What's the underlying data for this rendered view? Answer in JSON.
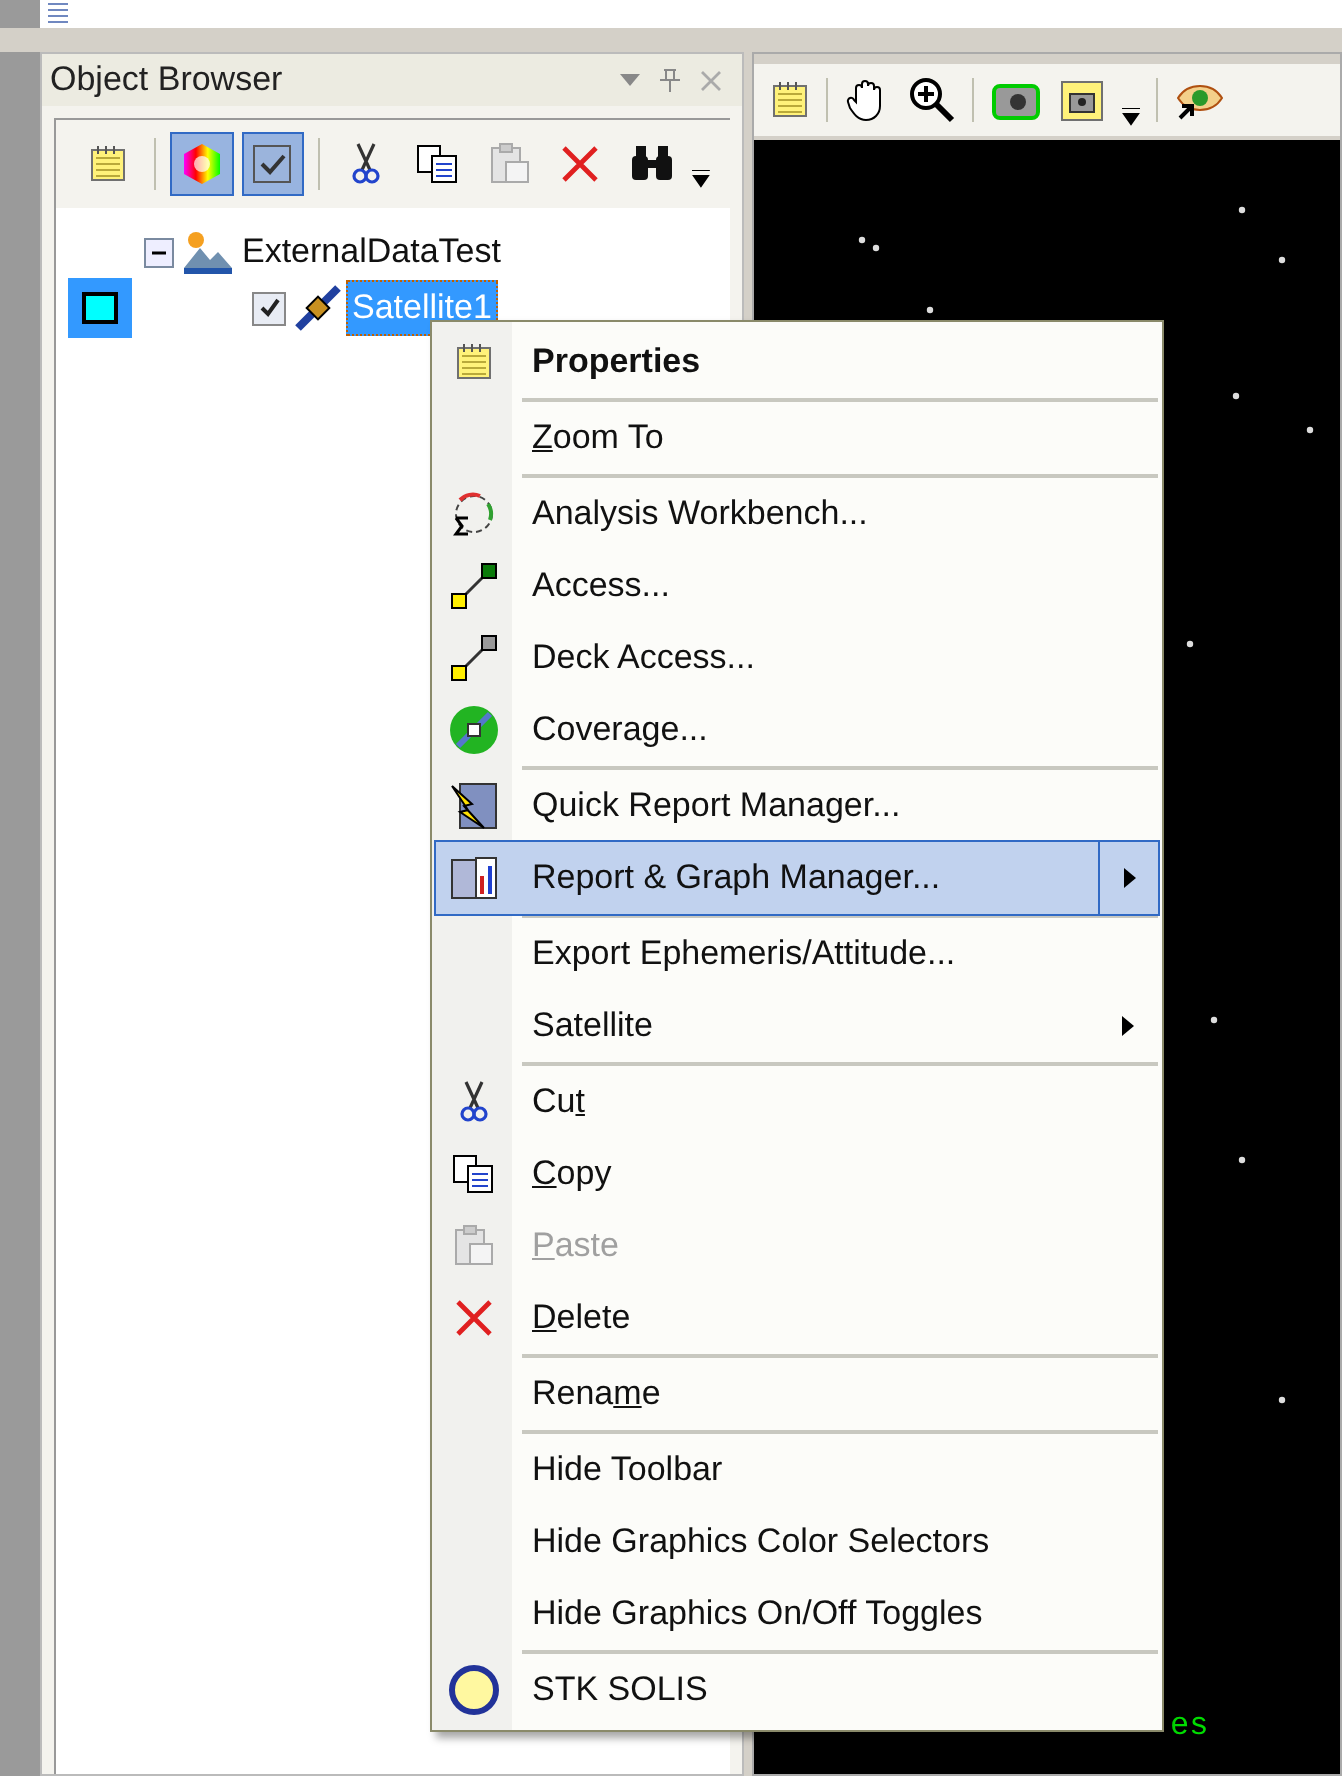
{
  "panel": {
    "title": "Object Browser"
  },
  "toolbar": [
    {
      "selected": false
    },
    {
      "selected": true
    },
    {
      "selected": true
    },
    {
      "selected": false
    },
    {
      "selected": false
    },
    {
      "selected": false
    },
    {
      "selected": false
    },
    {
      "selected": false
    }
  ],
  "tree": [
    {
      "label": "ExternalDataTest",
      "expanded": true,
      "children": [
        {
          "label": "Satellite1",
          "checked": true,
          "selected": true,
          "color": "#00ffff"
        }
      ]
    }
  ],
  "viewer": {
    "caption": "es"
  },
  "menu": [
    {
      "kind": "item",
      "label": "Properties",
      "default": true,
      "disabled": false,
      "selected": false,
      "submenu": false
    },
    {
      "kind": "separator"
    },
    {
      "kind": "item",
      "parts": {
        "key": "Z",
        "post": "oom To"
      },
      "default": false,
      "disabled": false,
      "selected": false,
      "submenu": false
    },
    {
      "kind": "separator"
    },
    {
      "kind": "item",
      "label": "Analysis Workbench...",
      "default": false,
      "disabled": false,
      "selected": false,
      "submenu": false
    },
    {
      "kind": "item",
      "label": "Access...",
      "default": false,
      "disabled": false,
      "selected": false,
      "submenu": false
    },
    {
      "kind": "item",
      "label": "Deck Access...",
      "default": false,
      "disabled": false,
      "selected": false,
      "submenu": false
    },
    {
      "kind": "item",
      "label": "Coverage...",
      "default": false,
      "disabled": false,
      "selected": false,
      "submenu": false
    },
    {
      "kind": "separator"
    },
    {
      "kind": "item",
      "label": "Quick Report Manager...",
      "default": false,
      "disabled": false,
      "selected": false,
      "submenu": false
    },
    {
      "kind": "item",
      "label": "Report & Graph Manager...",
      "default": false,
      "disabled": false,
      "selected": true,
      "submenu": true
    },
    {
      "kind": "separator"
    },
    {
      "kind": "item",
      "label": "Export Ephemeris/Attitude...",
      "default": false,
      "disabled": false,
      "selected": false,
      "submenu": false
    },
    {
      "kind": "item",
      "label": "Satellite",
      "default": false,
      "disabled": false,
      "selected": false,
      "submenu": true
    },
    {
      "kind": "separator"
    },
    {
      "kind": "item",
      "parts": {
        "pre": "Cu",
        "key": "t"
      },
      "default": false,
      "disabled": false,
      "selected": false,
      "submenu": false
    },
    {
      "kind": "item",
      "parts": {
        "key": "C",
        "post": "opy"
      },
      "default": false,
      "disabled": false,
      "selected": false,
      "submenu": false
    },
    {
      "kind": "item",
      "parts": {
        "key": "P",
        "post": "aste"
      },
      "default": false,
      "disabled": true,
      "selected": false,
      "submenu": false
    },
    {
      "kind": "item",
      "parts": {
        "key": "D",
        "post": "elete"
      },
      "default": false,
      "disabled": false,
      "selected": false,
      "submenu": false
    },
    {
      "kind": "separator"
    },
    {
      "kind": "item",
      "parts": {
        "pre": "Rena",
        "key": "m",
        "post": "e"
      },
      "default": false,
      "disabled": false,
      "selected": false,
      "submenu": false
    },
    {
      "kind": "separator"
    },
    {
      "kind": "item",
      "label": "Hide Toolbar",
      "default": false,
      "disabled": false,
      "selected": false,
      "submenu": false
    },
    {
      "kind": "item",
      "label": "Hide Graphics Color Selectors",
      "default": false,
      "disabled": false,
      "selected": false,
      "submenu": false
    },
    {
      "kind": "item",
      "label": "Hide Graphics On/Off Toggles",
      "default": false,
      "disabled": false,
      "selected": false,
      "submenu": false
    },
    {
      "kind": "separator"
    },
    {
      "kind": "item",
      "label": "STK SOLIS",
      "default": false,
      "disabled": false,
      "selected": false,
      "submenu": false
    }
  ]
}
